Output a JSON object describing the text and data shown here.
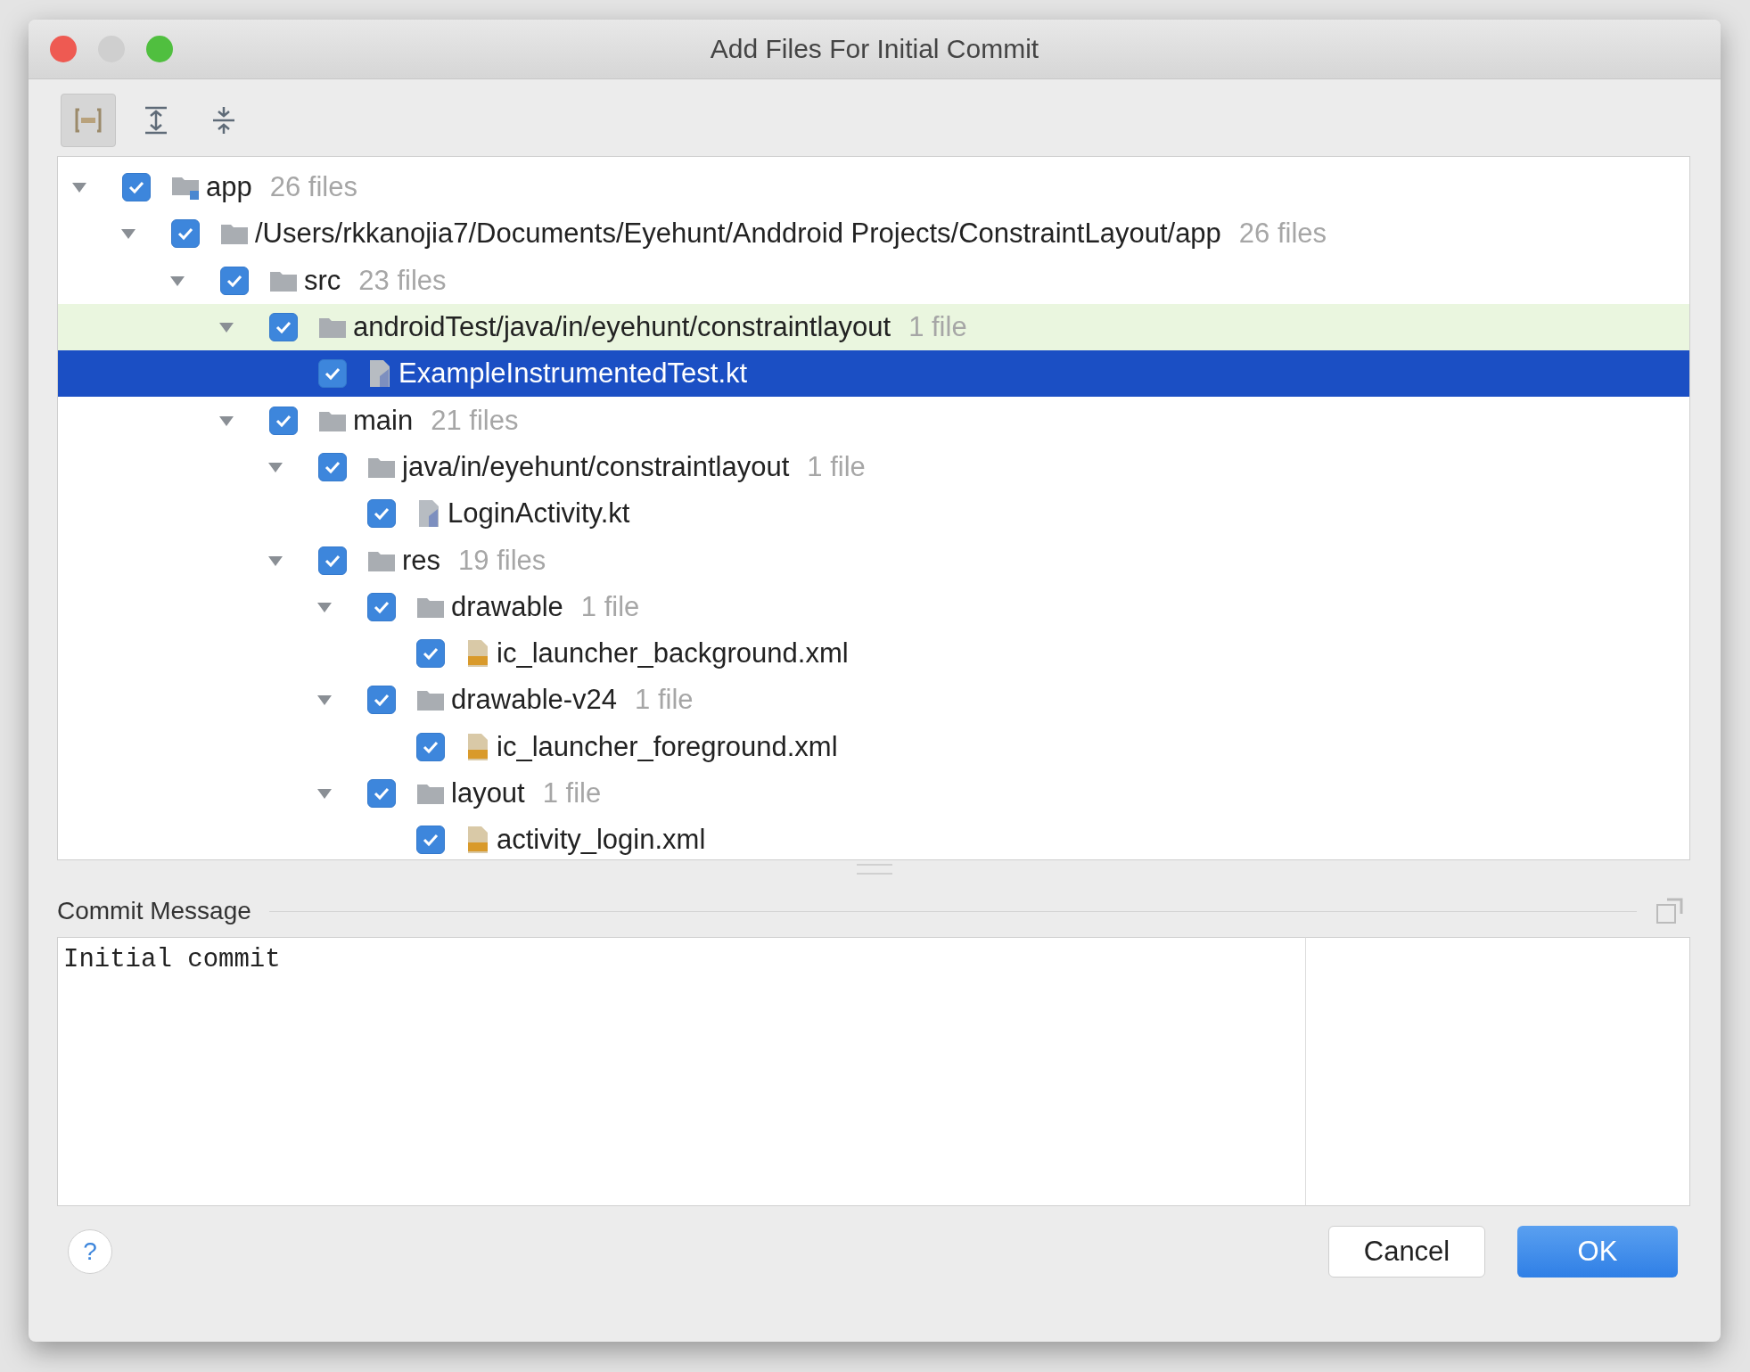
{
  "window": {
    "title": "Add Files For Initial Commit"
  },
  "tree": [
    {
      "name": "app",
      "count": "26 files",
      "kind": "module",
      "checked": true,
      "expanded": true,
      "selected": false,
      "hovered": false,
      "children": [
        {
          "name": "/Users/rkkanojia7/Documents/Eyehunt/Anddroid Projects/ConstraintLayout/app",
          "count": "26 files",
          "kind": "folder",
          "checked": true,
          "expanded": true,
          "selected": false,
          "hovered": false,
          "children": [
            {
              "name": "src",
              "count": "23 files",
              "kind": "folder",
              "checked": true,
              "expanded": true,
              "selected": false,
              "hovered": false,
              "children": [
                {
                  "name": "androidTest/java/in/eyehunt/constraintlayout",
                  "count": "1 file",
                  "kind": "folder",
                  "checked": true,
                  "expanded": true,
                  "selected": false,
                  "hovered": true,
                  "children": [
                    {
                      "name": "ExampleInstrumentedTest.kt",
                      "kind": "kotlin",
                      "checked": true,
                      "selected": true,
                      "hovered": false
                    }
                  ]
                },
                {
                  "name": "main",
                  "count": "21 files",
                  "kind": "folder",
                  "checked": true,
                  "expanded": true,
                  "selected": false,
                  "hovered": false,
                  "children": [
                    {
                      "name": "java/in/eyehunt/constraintlayout",
                      "count": "1 file",
                      "kind": "folder",
                      "checked": true,
                      "expanded": true,
                      "selected": false,
                      "hovered": false,
                      "children": [
                        {
                          "name": "LoginActivity.kt",
                          "kind": "kotlin",
                          "checked": true,
                          "selected": false,
                          "hovered": false
                        }
                      ]
                    },
                    {
                      "name": "res",
                      "count": "19 files",
                      "kind": "folder",
                      "checked": true,
                      "expanded": true,
                      "selected": false,
                      "hovered": false,
                      "children": [
                        {
                          "name": "drawable",
                          "count": "1 file",
                          "kind": "folder",
                          "checked": true,
                          "expanded": true,
                          "selected": false,
                          "hovered": false,
                          "children": [
                            {
                              "name": "ic_launcher_background.xml",
                              "kind": "xml",
                              "checked": true,
                              "selected": false,
                              "hovered": false
                            }
                          ]
                        },
                        {
                          "name": "drawable-v24",
                          "count": "1 file",
                          "kind": "folder",
                          "checked": true,
                          "expanded": true,
                          "selected": false,
                          "hovered": false,
                          "children": [
                            {
                              "name": "ic_launcher_foreground.xml",
                              "kind": "xml",
                              "checked": true,
                              "selected": false,
                              "hovered": false
                            }
                          ]
                        },
                        {
                          "name": "layout",
                          "count": "1 file",
                          "kind": "folder",
                          "checked": true,
                          "expanded": true,
                          "selected": false,
                          "hovered": false,
                          "children": [
                            {
                              "name": "activity_login.xml",
                              "kind": "xml",
                              "checked": true,
                              "selected": false,
                              "hovered": false
                            }
                          ]
                        }
                      ]
                    }
                  ]
                }
              ]
            }
          ]
        }
      ]
    }
  ],
  "commit_message": {
    "label": "Commit Message",
    "value": "Initial commit"
  },
  "buttons": {
    "help": "?",
    "cancel": "Cancel",
    "ok": "OK"
  }
}
